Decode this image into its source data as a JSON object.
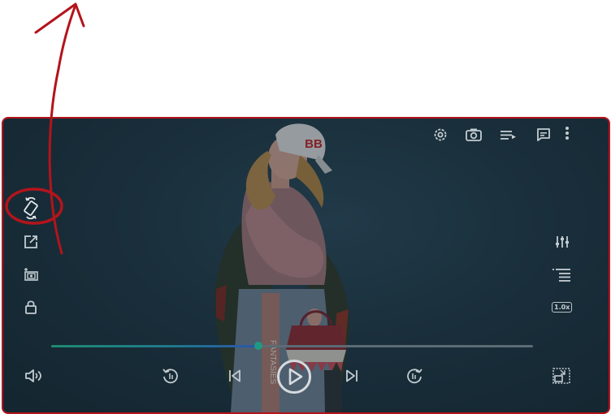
{
  "player": {
    "speed_label": "1.0x",
    "progress": 0.43,
    "cap_text": "BB",
    "belt_text": "FANTASIES"
  },
  "icons": {
    "top_right": [
      "settings-icon",
      "camera-icon",
      "playlist-icon",
      "subtitles-icon",
      "more-vertical-icon"
    ],
    "left": [
      "rotate-screen-icon",
      "open-external-icon",
      "screenshot-icon",
      "lock-icon"
    ],
    "right": [
      "equalizer-icon",
      "playlist-queue-icon",
      "playback-speed-icon"
    ],
    "bottom": [
      "volume-icon",
      "replay-10-icon",
      "previous-icon",
      "play-icon",
      "next-icon",
      "forward-10-icon",
      "picture-in-picture-icon"
    ]
  },
  "colors": {
    "annotation": "#b3141b",
    "progress_start": "#1f8a70",
    "progress_end": "#2a56a8",
    "icon": "#c4ccd1"
  }
}
